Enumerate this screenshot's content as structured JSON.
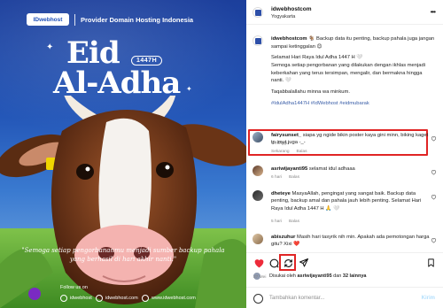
{
  "image": {
    "brand_logo": "IDwebhost",
    "brand_tagline": "Provider Domain Hosting Indonesia",
    "headline_line1": "Eid",
    "headline_badge": "1447H",
    "headline_line2": "Al-Adha",
    "caption_line1": "\"Semoga setiap pengorbananmu menjadi sumber backup pahala",
    "caption_line2": "yang berhasil di hari akhir nanti.\"",
    "follow_us": "Follow us on",
    "social": [
      "idwebhost",
      "idwebhost.com",
      "www.idwebhost.com"
    ],
    "colors": {
      "bg_top": "#1c3f9c",
      "bg_bottom": "#86b6e6",
      "accent": "#ffffff"
    }
  },
  "header": {
    "account": "idwebhostcom",
    "location": "Yogyakarta",
    "more_icon": "more-horizontal-icon"
  },
  "caption": {
    "author": "idwebhostcom",
    "intro": "🐐 Backup data itu penting, backup pahala juga jangan sampai ketinggalan 😊",
    "para1": "Selamat Hari Raya Idul Adha 1447 H 🤍",
    "para2": "Semoga setiap pengorbanan yang dilakukan dengan ikhlas menjadi keberkahan yang terus tersimpan, mengalir, dan bermakna hingga nanti. 🤍",
    "para3": "Taqabbalallahu minna wa minkum.",
    "tags": "#IdulAdha1447H #IdWebhost #eidmubarak",
    "time": "1 minggu"
  },
  "comments": [
    {
      "user": "fairysunset_",
      "text": "siapa yg ngide bikin poster kaya gini minn, biking kaget tp imut juga -_-",
      "time": "Sekarang",
      "reply": "Balas"
    },
    {
      "user": "asriwijayanti95",
      "text": "selamat idul adhaaa",
      "time": "6 hari",
      "reply": "Balas"
    },
    {
      "user": "dheteye",
      "text": "MasyaAllah, pengingat yang sangat baik. Backup data penting, backup amal dan pahala jauh lebih penting. Selamat Hari Raya Idul Adha 1447 H 🙏 🤍",
      "time": "5 hari",
      "reply": "Balas"
    },
    {
      "user": "abiszuhur",
      "text": "Masih hari tasyrik nih min. Apakah ada pemotongan harga gitu? Xixi ❤️",
      "time": "",
      "reply": ""
    }
  ],
  "actions": {
    "liked_prefix": "Disukai oleh",
    "liked_user": "asriwijayanti95",
    "liked_and": "dan",
    "liked_others": "32 lainnya",
    "date": "27 Mei"
  },
  "composer": {
    "placeholder": "Tambahkan komentar...",
    "send_label": "Kirim"
  }
}
